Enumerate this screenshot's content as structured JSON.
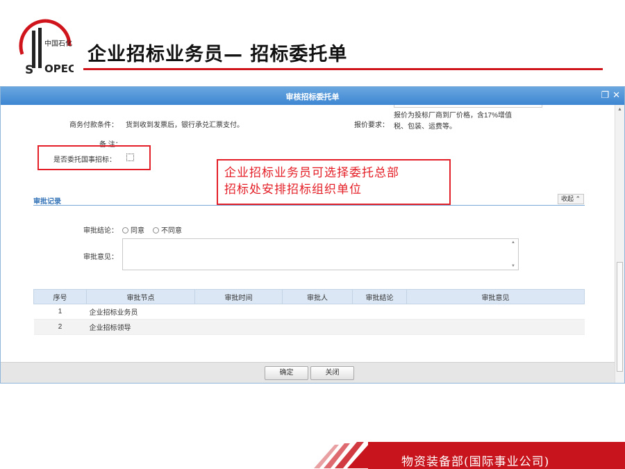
{
  "slide": {
    "logo_text": "中国石化 SINOPEC",
    "title": "企业招标业务员— 招标委托单",
    "footer": "物资装备部(国际事业公司)",
    "accent_color": "#d0141c"
  },
  "dialog": {
    "title": "审核招标委托单",
    "restore_icon": "restore-window-icon",
    "close_icon": "close-icon",
    "fields": {
      "payment_label": "商务付款条件：",
      "payment_value": "货到收到发票后，银行承兑汇票支付。",
      "quote_label": "报价要求：",
      "quote_value_line1": "报价为投标厂商到厂价格，含17%增值",
      "quote_value_line2": "税、包装、运费等。",
      "remark_label": "备  注：",
      "entrust_label": "是否委托国事招标："
    },
    "callout": {
      "line1": "企业招标业务员可选择委托总部",
      "line2": "招标处安排招标组织单位"
    },
    "approval": {
      "section_title": "审批记录",
      "collapse_label": "收起 ⌃",
      "conclusion_label": "审批结论：",
      "option_agree": "同意",
      "option_disagree": "不同意",
      "opinion_label": "审批意见："
    },
    "table": {
      "headers": [
        "序号",
        "审批节点",
        "审批时间",
        "审批人",
        "审批结论",
        "审批意见"
      ],
      "rows": [
        {
          "no": "1",
          "node": "企业招标业务员",
          "time": "",
          "person": "",
          "result": "",
          "opinion": ""
        },
        {
          "no": "2",
          "node": "企业招标领导",
          "time": "",
          "person": "",
          "result": "",
          "opinion": ""
        }
      ]
    },
    "buttons": {
      "confirm": "确定",
      "close": "关闭"
    }
  }
}
